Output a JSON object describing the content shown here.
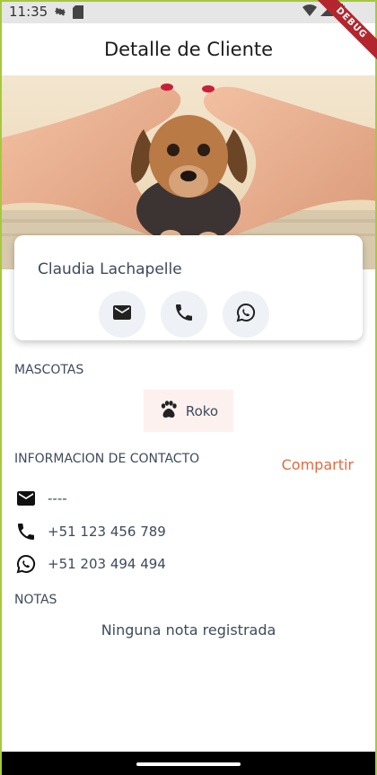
{
  "status_bar": {
    "time": "11:35"
  },
  "debug_label": "DEBUG",
  "app_bar": {
    "title": "Detalle de Cliente"
  },
  "customer": {
    "name": "Claudia Lachapelle"
  },
  "card_actions": [
    {
      "icon": "email-icon"
    },
    {
      "icon": "phone-icon"
    },
    {
      "icon": "whatsapp-icon"
    }
  ],
  "pets": {
    "title": "MASCOTAS",
    "items": [
      {
        "icon": "paw-icon",
        "name": "Roko"
      }
    ]
  },
  "contact": {
    "title": "INFORMACION DE CONTACTO",
    "share_label": "Compartir",
    "email": "----",
    "phone": "+51 123 456 789",
    "whatsapp": "+51 203 494 494"
  },
  "notes": {
    "title": "NOTAS",
    "empty": "Ninguna nota registrada"
  },
  "colors": {
    "accent": "#e4693f",
    "text": "#3e4a5c",
    "chip_bg": "#fdf1f0",
    "button_bg": "#eef1f5"
  }
}
